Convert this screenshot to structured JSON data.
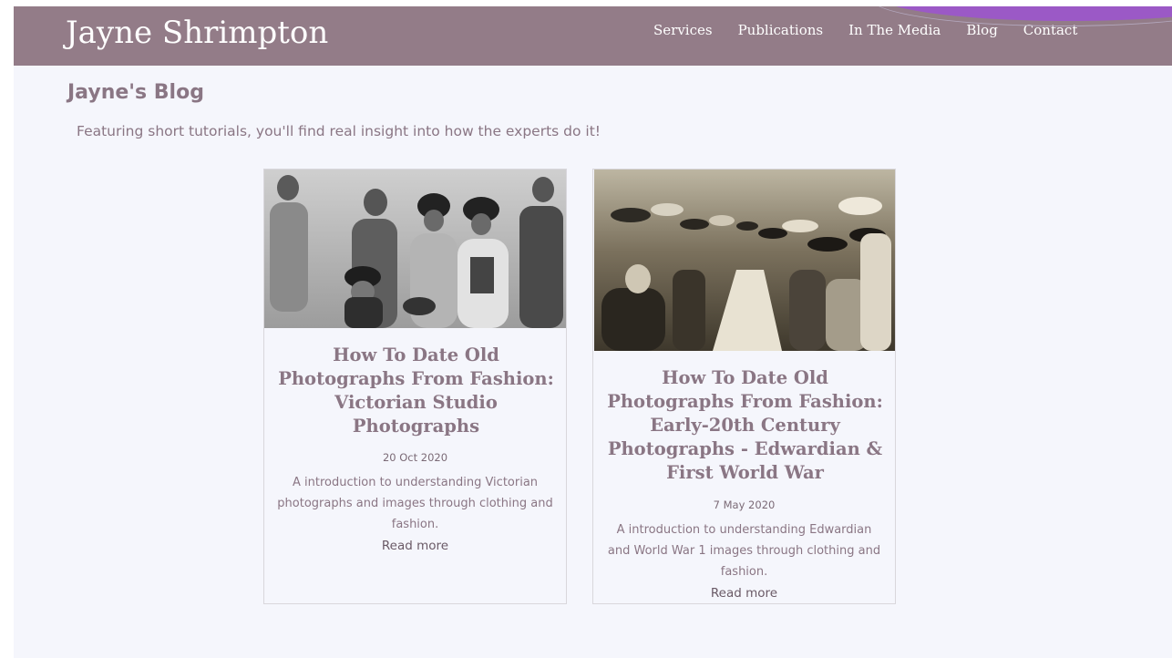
{
  "colors": {
    "header_bg": "#937c88",
    "page_bg": "#f5f6fc",
    "accent_text": "#8a7684",
    "corner_accent": "#9b59c6"
  },
  "header": {
    "site_title": "Jayne Shrimpton",
    "nav": [
      {
        "label": "Services"
      },
      {
        "label": "Publications"
      },
      {
        "label": "In The Media"
      },
      {
        "label": "Blog"
      },
      {
        "label": "Contact"
      }
    ]
  },
  "main": {
    "heading": "Jayne's Blog",
    "intro": "Featuring short tutorials, you'll find real insight into how the experts do it!",
    "posts": [
      {
        "title": "How To Date Old Photographs From Fashion: Victorian Studio Photographs",
        "date": "20 Oct 2020",
        "description": "A introduction to understanding Victorian photographs and images through clothing and fashion.",
        "read_more": "Read more",
        "image_icon": "victorian-group-photo"
      },
      {
        "title": "How To Date Old Photographs From Fashion: Early-20th Century Photographs - Edwardian & First World War",
        "date": "7 May 2020",
        "description": "A introduction to understanding Edwardian and World War 1 images through clothing and fashion.",
        "read_more": "Read more",
        "image_icon": "edwardian-street-party-photo"
      }
    ]
  }
}
